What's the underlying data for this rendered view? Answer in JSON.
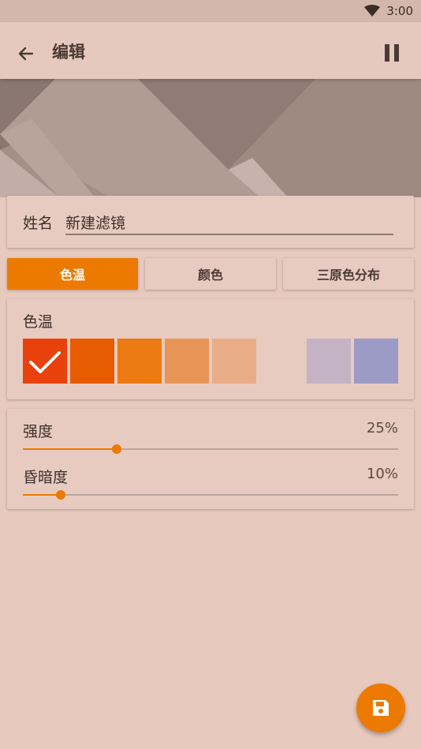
{
  "status": {
    "time": "3:00",
    "wifi_icon": "wifi-icon"
  },
  "toolbar": {
    "title": "编辑",
    "back_icon": "arrow-left-icon",
    "pause_icon": "pause-icon"
  },
  "name": {
    "label": "姓名",
    "value": "新建滤镜"
  },
  "tabs": [
    {
      "label": "色温",
      "active": true
    },
    {
      "label": "颜色",
      "active": false
    },
    {
      "label": "三原色分布",
      "active": false
    }
  ],
  "color_temperature": {
    "label": "色温",
    "swatches": [
      {
        "color": "#e8410b",
        "selected": true
      },
      {
        "color": "#e85c00",
        "selected": false
      },
      {
        "color": "#ec7a12",
        "selected": false
      },
      {
        "color": "#e99558",
        "selected": false
      },
      {
        "color": "#e8ad87",
        "selected": false
      },
      {
        "color": "#c3b3c4",
        "selected": false
      },
      {
        "color": "#9c9bc6",
        "selected": false
      }
    ]
  },
  "sliders": [
    {
      "label": "强度",
      "value_text": "25%",
      "value": 0.25
    },
    {
      "label": "昏暗度",
      "value_text": "10%",
      "value": 0.1
    }
  ],
  "fab": {
    "icon": "save-icon"
  },
  "colors": {
    "accent": "#ec7a00",
    "background": "#e7c9bd"
  }
}
